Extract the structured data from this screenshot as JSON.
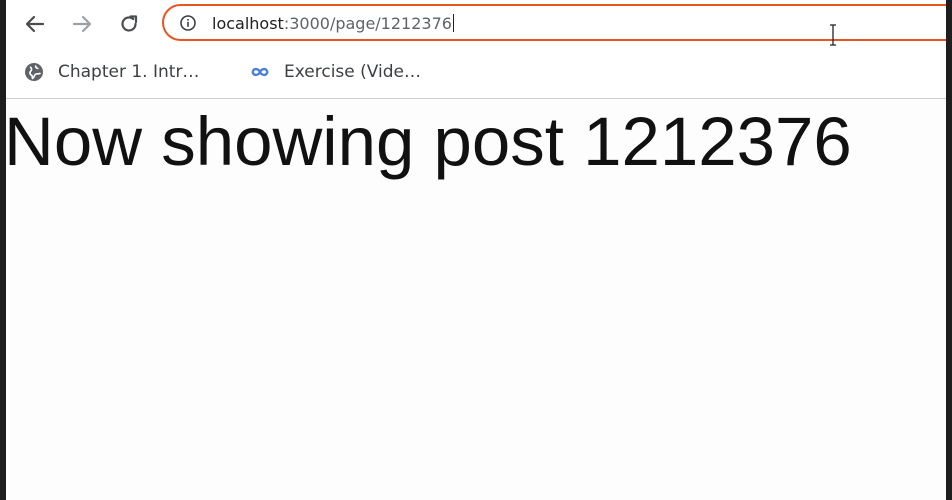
{
  "browser": {
    "toolbar": {
      "back_icon": "arrow-left-icon",
      "forward_icon": "arrow-right-icon",
      "reload_icon": "reload-icon"
    },
    "omnibox": {
      "info_icon": "info-circle-icon",
      "url_host": "localhost",
      "url_rest": ":3000/page/1212376",
      "focus_color": "#e8551f"
    },
    "bookmarks": [
      {
        "label": "Chapter 1. Intr…",
        "icon": "globe-icon"
      },
      {
        "label": "Exercise (Vide…",
        "icon": "infinity-icon",
        "icon_color": "#4a7fd4"
      }
    ]
  },
  "page": {
    "heading": "Now showing post 1212376"
  }
}
